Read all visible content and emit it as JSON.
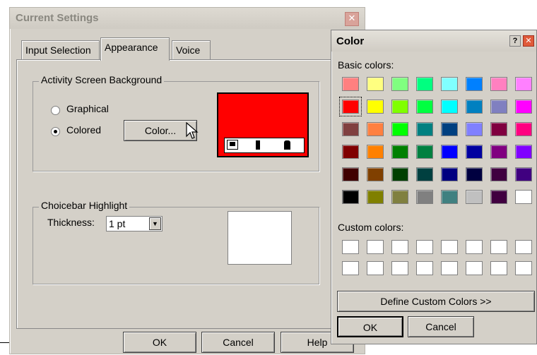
{
  "main_dialog": {
    "title": "Current Settings",
    "close_glyph": "✕",
    "tabs": [
      {
        "label": "Input Selection"
      },
      {
        "label": "Appearance"
      },
      {
        "label": "Voice"
      }
    ],
    "background_group": {
      "label": "Activity Screen Background",
      "radio_graphical": "Graphical",
      "radio_colored": "Colored",
      "selected": "Colored",
      "color_button": "Color...",
      "preview_color": "#ff0000"
    },
    "choicebar_group": {
      "label": "Choicebar Highlight",
      "thickness_label": "Thickness:",
      "thickness_value": "1 pt"
    },
    "buttons": {
      "ok": "OK",
      "cancel": "Cancel",
      "help": "Help"
    }
  },
  "color_dialog": {
    "title": "Color",
    "help_glyph": "?",
    "close_glyph": "✕",
    "basic_colors_label": "Basic colors:",
    "basic_colors": [
      [
        "#ff8080",
        "#ffff80",
        "#80ff80",
        "#00ff80",
        "#80ffff",
        "#0080ff",
        "#ff80c0",
        "#ff80ff"
      ],
      [
        "#ff0000",
        "#ffff00",
        "#80ff00",
        "#00ff40",
        "#00ffff",
        "#0080c0",
        "#8080c0",
        "#ff00ff"
      ],
      [
        "#804040",
        "#ff8040",
        "#00ff00",
        "#008080",
        "#004080",
        "#8080ff",
        "#800040",
        "#ff0080"
      ],
      [
        "#800000",
        "#ff8000",
        "#008000",
        "#008040",
        "#0000ff",
        "#0000a0",
        "#800080",
        "#8000ff"
      ],
      [
        "#400000",
        "#804000",
        "#004000",
        "#004040",
        "#000080",
        "#000040",
        "#400040",
        "#400080"
      ],
      [
        "#000000",
        "#808000",
        "#808040",
        "#808080",
        "#408080",
        "#c0c0c0",
        "#400040",
        "#ffffff"
      ]
    ],
    "selected_color": "#ff0000",
    "custom_colors_label": "Custom colors:",
    "define_button": "Define Custom Colors >>",
    "ok": "OK",
    "cancel": "Cancel"
  }
}
